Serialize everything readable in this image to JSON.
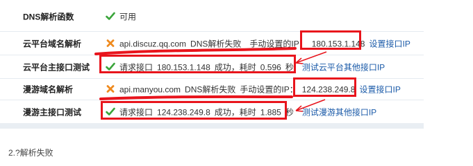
{
  "rows": [
    {
      "label": "DNS解析函数",
      "status": "ok",
      "text": "可用"
    },
    {
      "label": "云平台域名解析",
      "status": "fail",
      "host": "api.discuz.qq.com",
      "fail_text": "DNS解析失败",
      "manual_label": "手动设置的IP：",
      "manual_ip": "180.153.1.148",
      "link": "设置接口IP"
    },
    {
      "label": "云平台主接口测试",
      "status": "ok",
      "request_label": "请求接口",
      "ip": "180.153.1.148",
      "result": "成功，耗时",
      "time": "0.596",
      "unit": "秒",
      "link": "测试云平台其他接口IP"
    },
    {
      "label": "漫游域名解析",
      "status": "fail",
      "host": "api.manyou.com",
      "fail_text": "DNS解析失败",
      "manual_label": "手动设置的IP：",
      "manual_ip": "124.238.249.8",
      "link": "设置接口IP"
    },
    {
      "label": "漫游主接口测试",
      "status": "ok",
      "request_label": "请求接口",
      "ip": "124.238.249.8",
      "result": "成功，耗时",
      "time": "1.885",
      "unit": "秒",
      "link": "测试漫游其他接口IP"
    }
  ],
  "footer_text": "2.?解析失败",
  "colors": {
    "ok": "#3aa53a",
    "fail": "#ef8a1e",
    "annotation": "#e8141c",
    "link": "#1a5aa8"
  }
}
